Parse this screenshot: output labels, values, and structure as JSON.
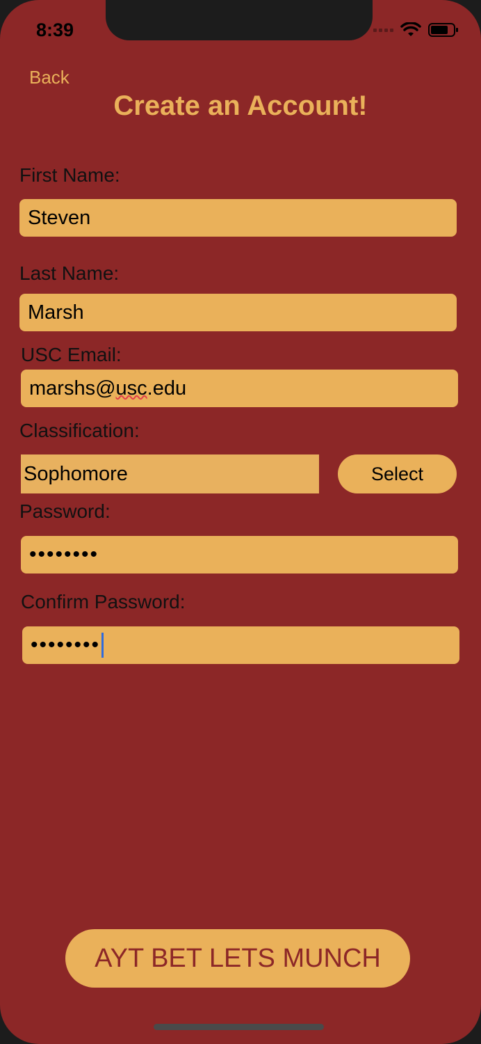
{
  "status_bar": {
    "time": "8:39"
  },
  "nav": {
    "back_label": "Back"
  },
  "page": {
    "title": "Create an Account!"
  },
  "form": {
    "first_name": {
      "label": "First Name:",
      "value": "Steven"
    },
    "last_name": {
      "label": "Last Name:",
      "value": "Marsh"
    },
    "email": {
      "label": "USC Email:",
      "value_prefix": "marshs@",
      "value_flagged": "usc",
      "value_suffix": ".edu"
    },
    "classification": {
      "label": "Classification:",
      "value": "Sophomore",
      "select_label": "Select"
    },
    "password": {
      "label": "Password:",
      "value": "••••••••"
    },
    "confirm_password": {
      "label": "Confirm Password:",
      "value": "••••••••"
    }
  },
  "submit": {
    "label": "AYT BET LETS MUNCH"
  },
  "colors": {
    "background": "#8c2727",
    "accent": "#eab15a",
    "caret": "#2f6bdd"
  }
}
